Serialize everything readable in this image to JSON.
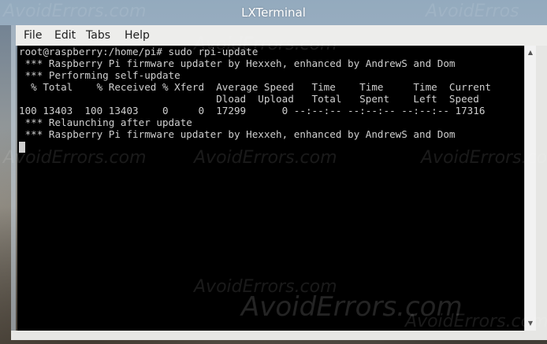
{
  "window": {
    "title": "LXTerminal"
  },
  "menubar": {
    "items": [
      "File",
      "Edit",
      "Tabs",
      "Help"
    ]
  },
  "terminal": {
    "lines": [
      "root@raspberry:/home/pi# sudo rpi-update",
      " *** Raspberry Pi firmware updater by Hexxeh, enhanced by AndrewS and Dom",
      " *** Performing self-update",
      "  % Total    % Received % Xferd  Average Speed   Time    Time     Time  Current",
      "                                 Dload  Upload   Total   Spent    Left  Speed",
      "100 13403  100 13403    0     0  17299      0 --:--:-- --:--:-- --:--:-- 17316",
      " *** Relaunching after update",
      " *** Raspberry Pi firmware updater by Hexxeh, enhanced by AndrewS and Dom"
    ]
  },
  "scrollbar": {
    "up_icon": "▲",
    "down_icon": "▼"
  },
  "watermarks": [
    "AvoidErrors.com",
    "AvoidErrors.com",
    "AvoidErros",
    "AvoidErrors.com",
    "AvoidErrors.com",
    "AvoidErrors.com",
    "AvoidErrors.com",
    "AvoidErrors.com",
    "AvoidErrors.com"
  ]
}
